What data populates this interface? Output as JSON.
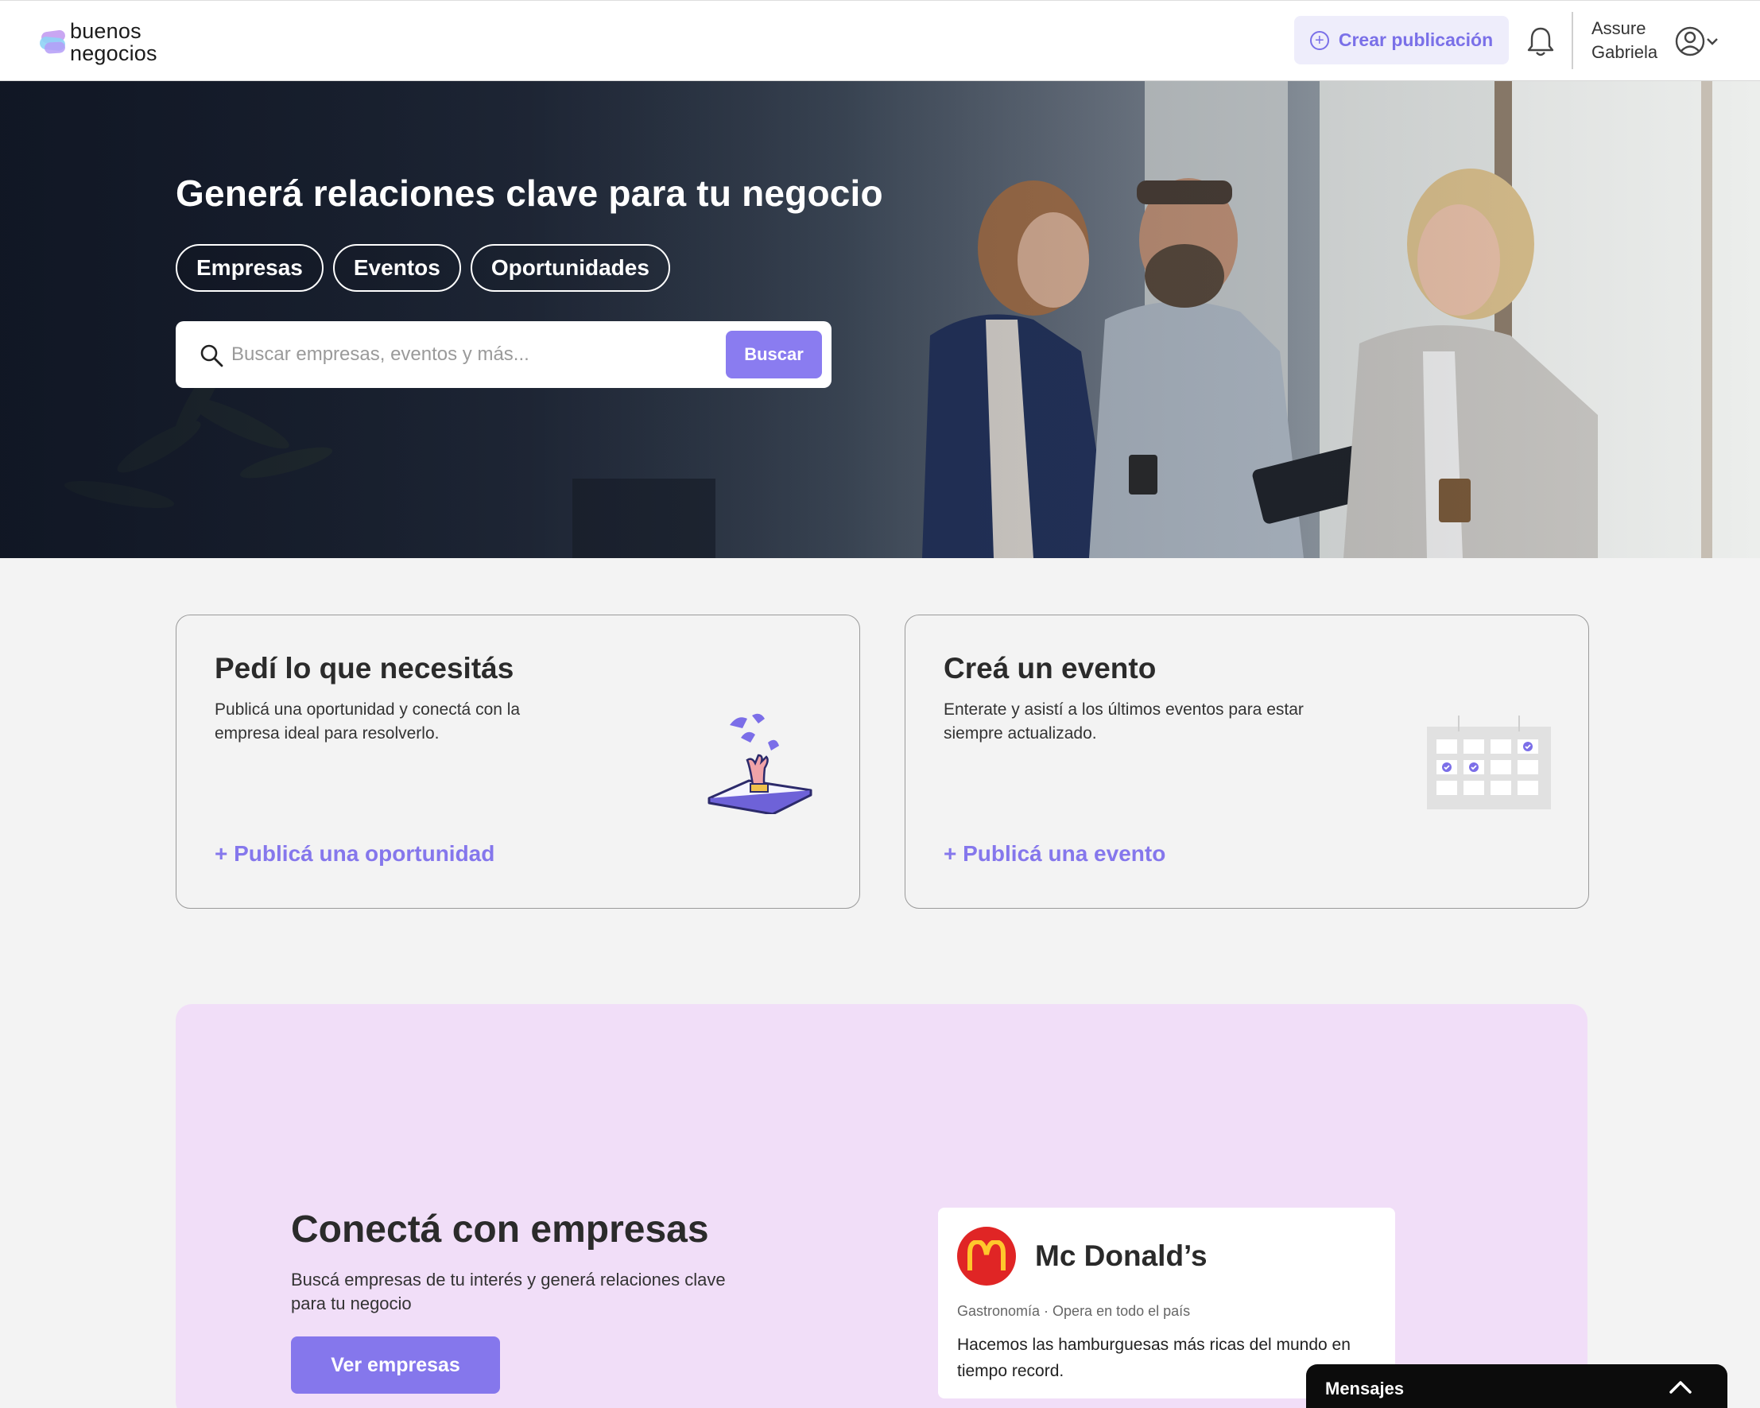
{
  "header": {
    "logo_line1": "buenos",
    "logo_line2": "negocios",
    "create_label": "Crear publicación",
    "user_first": "Assure",
    "user_last": "Gabriela"
  },
  "hero": {
    "title": "Generá relaciones clave para tu negocio",
    "chips": [
      "Empresas",
      "Eventos",
      "Oportunidades"
    ],
    "search_placeholder": "Buscar empresas, eventos y más...",
    "search_button": "Buscar"
  },
  "cards": [
    {
      "title": "Pedí lo que necesitás",
      "description": "Publicá una oportunidad y conectá con la empresa ideal para resolverlo.",
      "link": "+ Publicá una oportunidad",
      "icon": "hand-phone-icon"
    },
    {
      "title": "Creá un evento",
      "description": "Enterate y asistí a los últimos eventos para estar siempre actualizado.",
      "link": "+ Publicá una evento",
      "icon": "calendar-icon"
    }
  ],
  "connect": {
    "title": "Conectá con empresas",
    "description": "Buscá empresas de tu interés y generá relaciones clave para tu negocio",
    "button": "Ver empresas",
    "company": {
      "logo_letter": "M",
      "name": "Mc Donald’s",
      "meta": "Gastronomía · Opera en todo el país",
      "description": "Hacemos las hamburguesas más ricas del mundo en tiempo record."
    }
  },
  "messages": {
    "label": "Mensajes"
  },
  "colors": {
    "accent": "#8577ec",
    "accent_light": "#eeedfb",
    "section_bg": "#f1def8",
    "page_bg": "#f3f3f3"
  }
}
